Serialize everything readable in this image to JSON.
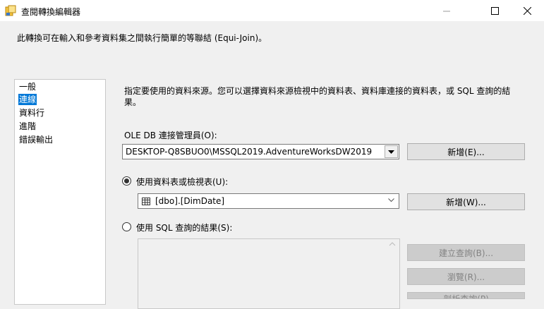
{
  "window": {
    "title": "查閱轉換編輯器",
    "icon": "lookup-transform-icon",
    "controls": [
      "minimize-icon",
      "maximize-icon",
      "close-icon"
    ]
  },
  "description": "此轉換可在輸入和參考資料集之間執行簡單的等聯結 (Equi-Join)。",
  "nav": {
    "items": [
      {
        "label": "一般",
        "selected": false
      },
      {
        "label": "連線",
        "selected": true
      },
      {
        "label": "資料行",
        "selected": false
      },
      {
        "label": "進階",
        "selected": false
      },
      {
        "label": "錯誤輸出",
        "selected": false
      }
    ]
  },
  "connection": {
    "instruction": "指定要使用的資料來源。您可以選擇資料來源檢視中的資料表、資料庫連接的資料表，或 SQL 查詢的結果。",
    "manager_label": "OLE DB 連接管理員(O):",
    "manager_value": "DESKTOP-Q8SBUO0\\MSSQL2019.AdventureWorksDW2019",
    "new_connection_label": "新增(E)...",
    "use_table_label": "使用資料表或檢視表(U):",
    "use_table_selected": true,
    "table_value": "[dbo].[DimDate]",
    "new_table_label": "新增(W)...",
    "use_sql_label": "使用 SQL 查詢的結果(S):",
    "use_sql_selected": false,
    "build_query_label": "建立查詢(B)...",
    "browse_label": "瀏覽(R)...",
    "parse_label": "剖析查詢(P)"
  },
  "colors": {
    "selection": "#0078d7",
    "window_bg": "#f0f0f0",
    "disabled_button_bg": "#cccccc",
    "disabled_text": "#838383"
  }
}
